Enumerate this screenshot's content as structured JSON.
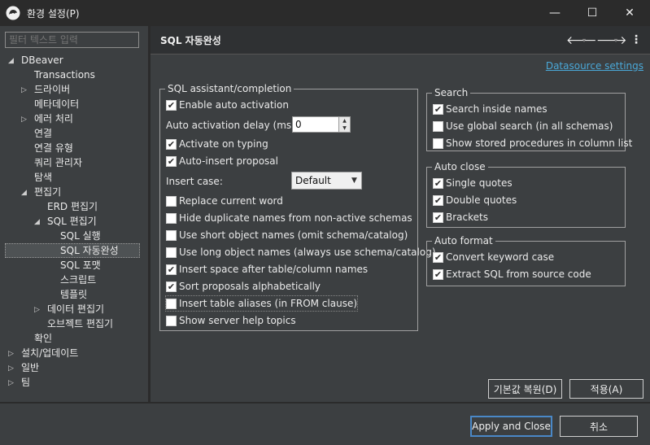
{
  "window": {
    "title": "환경 설정(P)",
    "minimize_glyph": "—",
    "maximize_glyph": "☐",
    "close_glyph": "✕"
  },
  "filter": {
    "placeholder": "필터 텍스트 입력"
  },
  "tree": {
    "items": [
      {
        "label": "DBeaver"
      },
      {
        "label": "Transactions"
      },
      {
        "label": "드라이버"
      },
      {
        "label": "메타데이터"
      },
      {
        "label": "에러 처리"
      },
      {
        "label": "연결"
      },
      {
        "label": "연결 유형"
      },
      {
        "label": "쿼리 관리자"
      },
      {
        "label": "탐색"
      },
      {
        "label": "편집기"
      },
      {
        "label": "ERD 편집기"
      },
      {
        "label": "SQL 편집기"
      },
      {
        "label": "SQL 실행"
      },
      {
        "label": "SQL 자동완성"
      },
      {
        "label": "SQL 포맷"
      },
      {
        "label": "스크립트"
      },
      {
        "label": "템플릿"
      },
      {
        "label": "데이터 편집기"
      },
      {
        "label": "오브젝트 편집기"
      },
      {
        "label": "확인"
      },
      {
        "label": "설치/업데이트"
      },
      {
        "label": "일반"
      },
      {
        "label": "팀"
      }
    ]
  },
  "page": {
    "title": "SQL 자동완성",
    "datasource_link": "Datasource settings"
  },
  "assistant": {
    "legend": "SQL assistant/completion",
    "enable_auto_activation": "Enable auto activation",
    "delay_label": "Auto activation delay (ms):",
    "delay_value": "0",
    "activate_on_typing": "Activate on typing",
    "auto_insert": "Auto-insert proposal",
    "insert_case_label": "Insert case:",
    "insert_case_value": "Default",
    "replace_word": "Replace current word",
    "hide_duplicates": "Hide duplicate names from non-active schemas",
    "short_names": "Use short object names (omit schema/catalog)",
    "long_names": "Use long object names (always use schema/catalog)",
    "insert_space": "Insert space after table/column names",
    "sort_alpha": "Sort proposals alphabetically",
    "insert_aliases": "Insert table aliases (in FROM clause)",
    "server_help": "Show server help topics"
  },
  "search": {
    "legend": "Search",
    "inside_names": "Search inside names",
    "global_search": "Use global search (in all schemas)",
    "stored_procs": "Show stored procedures in column list"
  },
  "autoclose": {
    "legend": "Auto close",
    "single_quotes": "Single quotes",
    "double_quotes": "Double quotes",
    "brackets": "Brackets"
  },
  "autoformat": {
    "legend": "Auto format",
    "keyword_case": "Convert keyword case",
    "extract_sql": "Extract SQL from source code"
  },
  "buttons": {
    "restore_defaults": "기본값 복원(D)",
    "apply": "적용(A)",
    "apply_close": "Apply and Close",
    "cancel": "취소"
  }
}
